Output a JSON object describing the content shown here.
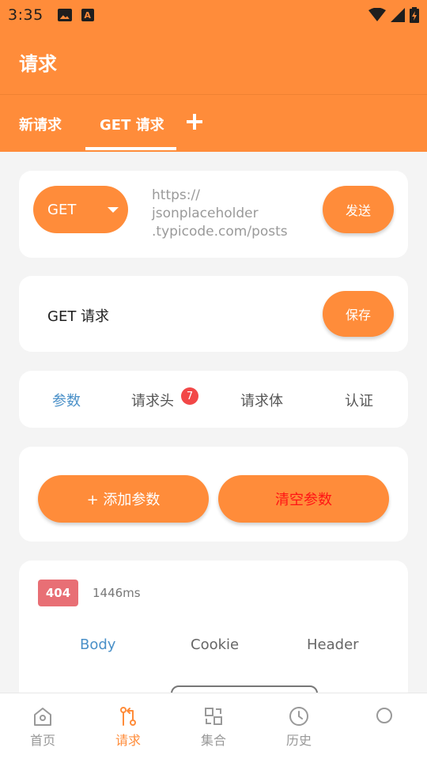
{
  "status_bar": {
    "time": "3:35"
  },
  "app_bar": {
    "title": "请求"
  },
  "tabs": [
    {
      "label": "新请求"
    },
    {
      "label": "GET 请求"
    }
  ],
  "request": {
    "method": "GET",
    "url_line1": "https://",
    "url_line2": "jsonplaceholder",
    "url_line3": ".typicode.com/posts",
    "send_label": "发送",
    "name": "GET 请求",
    "save_label": "保存"
  },
  "sub_tabs": [
    {
      "label": "参数"
    },
    {
      "label": "请求头",
      "badge": "7"
    },
    {
      "label": "请求体"
    },
    {
      "label": "认证"
    }
  ],
  "params": {
    "add_label": "+ 添加参数",
    "clear_label": "清空参数"
  },
  "response": {
    "status_code": "404",
    "time": "1446ms",
    "tabs": [
      "Body",
      "Cookie",
      "Header"
    ]
  },
  "bottom_nav": [
    {
      "label": "首页",
      "icon": "home-icon"
    },
    {
      "label": "请求",
      "icon": "request-icon"
    },
    {
      "label": "集合",
      "icon": "collection-icon"
    },
    {
      "label": "历史",
      "icon": "history-icon"
    }
  ],
  "colors": {
    "accent": "#ff8c3a",
    "link": "#4a90c8",
    "danger": "#ff1515",
    "status_404": "#e86f75"
  }
}
